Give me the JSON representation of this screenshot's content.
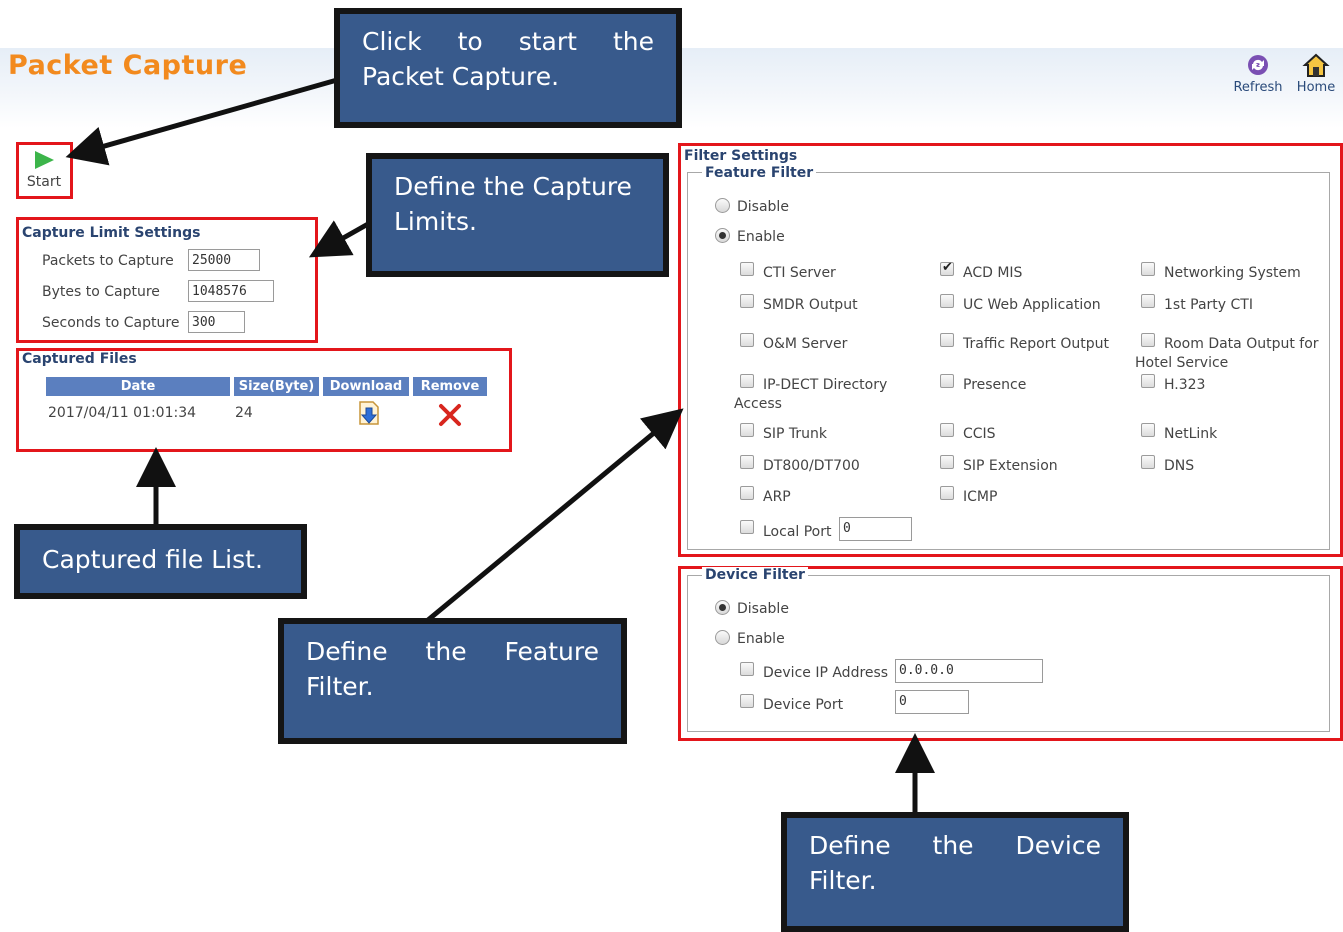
{
  "header": {
    "title": "Packet Capture",
    "refresh_label": "Refresh",
    "home_label": "Home"
  },
  "toolbar": {
    "start_label": "Start"
  },
  "capture_limits": {
    "title": "Capture Limit Settings",
    "packets_label": "Packets to Capture",
    "packets_value": "25000",
    "bytes_label": "Bytes to Capture",
    "bytes_value": "1048576",
    "seconds_label": "Seconds to Capture",
    "seconds_value": "300"
  },
  "captured_files": {
    "title": "Captured Files",
    "columns": [
      "Date",
      "Size(Byte)",
      "Download",
      "Remove"
    ],
    "rows": [
      {
        "date": "2017/04/11 01:01:34",
        "size": "24"
      }
    ]
  },
  "filter_settings": {
    "title": "Filter Settings",
    "feature_filter": {
      "legend": "Feature Filter",
      "disable_label": "Disable",
      "enable_label": "Enable",
      "selected": "Enable",
      "options": [
        {
          "label": "CTI Server",
          "checked": false
        },
        {
          "label": "ACD MIS",
          "checked": true
        },
        {
          "label": "Networking System",
          "checked": false
        },
        {
          "label": "SMDR Output",
          "checked": false
        },
        {
          "label": "UC Web Application",
          "checked": false
        },
        {
          "label": "1st Party CTI",
          "checked": false
        },
        {
          "label": "O&M Server",
          "checked": false
        },
        {
          "label": "Traffic Report Output",
          "checked": false
        },
        {
          "label": "Room Data Output for",
          "label2": "Hotel Service",
          "checked": false
        },
        {
          "label": "IP-DECT Directory",
          "label2": "Access",
          "checked": false
        },
        {
          "label": "Presence",
          "checked": false
        },
        {
          "label": "H.323",
          "checked": false
        },
        {
          "label": "SIP Trunk",
          "checked": false
        },
        {
          "label": "CCIS",
          "checked": false
        },
        {
          "label": "NetLink",
          "checked": false
        },
        {
          "label": "DT800/DT700",
          "checked": false
        },
        {
          "label": "SIP Extension",
          "checked": false
        },
        {
          "label": "DNS",
          "checked": false
        },
        {
          "label": "ARP",
          "checked": false
        },
        {
          "label": "ICMP",
          "checked": false
        }
      ],
      "local_port_label": "Local Port",
      "local_port_value": "0"
    },
    "device_filter": {
      "legend": "Device Filter",
      "disable_label": "Disable",
      "enable_label": "Enable",
      "selected": "Disable",
      "ip_label": "Device IP Address",
      "ip_value": "0.0.0.0",
      "port_label": "Device Port",
      "port_value": "0"
    }
  },
  "annotations": {
    "start": [
      "Click to start the",
      "Packet Capture."
    ],
    "limits": [
      "Define the Capture",
      "Limits."
    ],
    "files": [
      "Captured file List."
    ],
    "feature": [
      "Define the Feature",
      "Filter."
    ],
    "device": [
      "Define the Device",
      "Filter."
    ]
  },
  "colors": {
    "title_orange": "#f28a1e",
    "callout_blue": "#385a8c",
    "highlight_red": "#e3161b",
    "table_header": "#5b7fbf"
  }
}
